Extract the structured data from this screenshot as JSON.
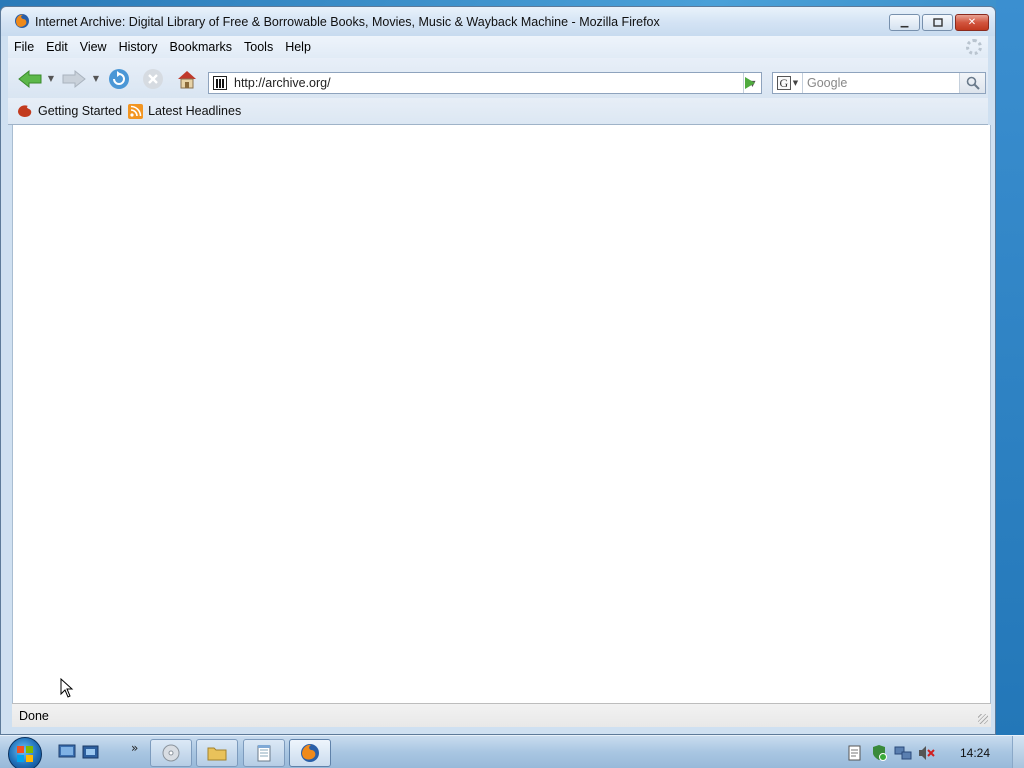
{
  "window": {
    "title": "Internet Archive: Digital Library of Free & Borrowable Books, Movies, Music & Wayback Machine - Mozilla Firefox",
    "caption_buttons": [
      "minimize",
      "restore",
      "close"
    ]
  },
  "menubar": {
    "items": [
      "File",
      "Edit",
      "View",
      "History",
      "Bookmarks",
      "Tools",
      "Help"
    ]
  },
  "navbar": {
    "url": "http://archive.org/",
    "search_placeholder": "Google",
    "search_engine": "G"
  },
  "bookmarks": {
    "items": [
      "Getting Started",
      "Latest Headlines"
    ]
  },
  "statusbar": {
    "text": "Done"
  },
  "taskbar": {
    "clock": "14:24",
    "quicklaunch_chevron": "»"
  }
}
